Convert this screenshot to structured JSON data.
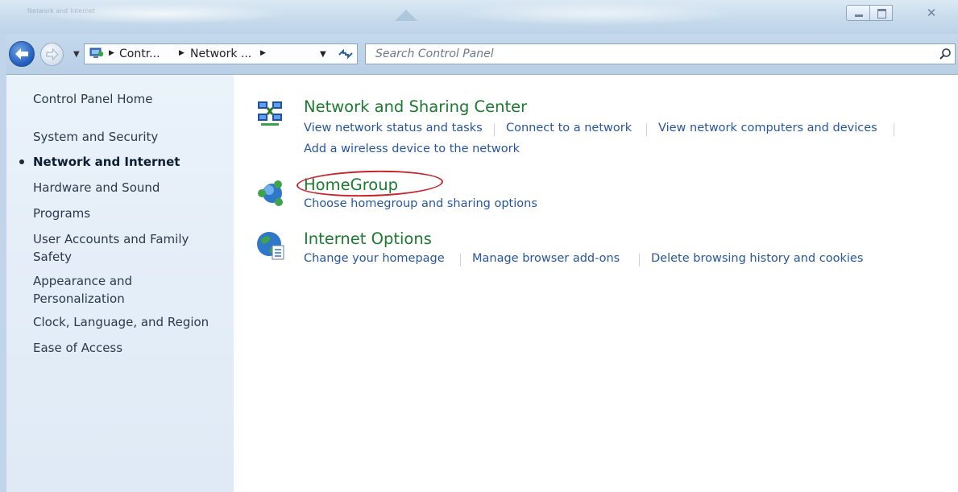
{
  "window": {
    "title_faded": "Network and Internet",
    "controls": {
      "minimize": "minimize-icon",
      "maximize": "maximize-icon",
      "close": "close-icon"
    }
  },
  "address_bar": {
    "crumbs": [
      "Contr...",
      "Network ..."
    ],
    "search_placeholder": "Search Control Panel"
  },
  "sidebar": {
    "items": [
      {
        "label": "Control Panel Home"
      },
      {
        "label": "System and Security"
      },
      {
        "label": "Network and Internet",
        "active": true
      },
      {
        "label": "Hardware and Sound"
      },
      {
        "label": "Programs"
      },
      {
        "label": "User Accounts and Family"
      },
      {
        "label": "Safety"
      },
      {
        "label": "Appearance and"
      },
      {
        "label": "Personalization"
      },
      {
        "label": "Clock, Language, and Region"
      },
      {
        "label": "Ease of Access"
      }
    ]
  },
  "categories": [
    {
      "title": "Network and Sharing Center",
      "icon": "network-sharing-icon",
      "links": [
        "View network status and tasks",
        "Connect to a network",
        "View network computers and devices",
        "Add a wireless device to the network"
      ]
    },
    {
      "title": "HomeGroup",
      "icon": "homegroup-icon",
      "links": [
        "Choose homegroup and sharing options"
      ]
    },
    {
      "title": "Internet Options",
      "icon": "internet-options-icon",
      "links": [
        "Change your homepage",
        "Manage browser add-ons",
        "Delete browsing history and cookies"
      ]
    }
  ],
  "colors": {
    "category_title": "#1b7a2f",
    "task_link": "#2755a3",
    "highlight_annotation": "#c8242b"
  }
}
